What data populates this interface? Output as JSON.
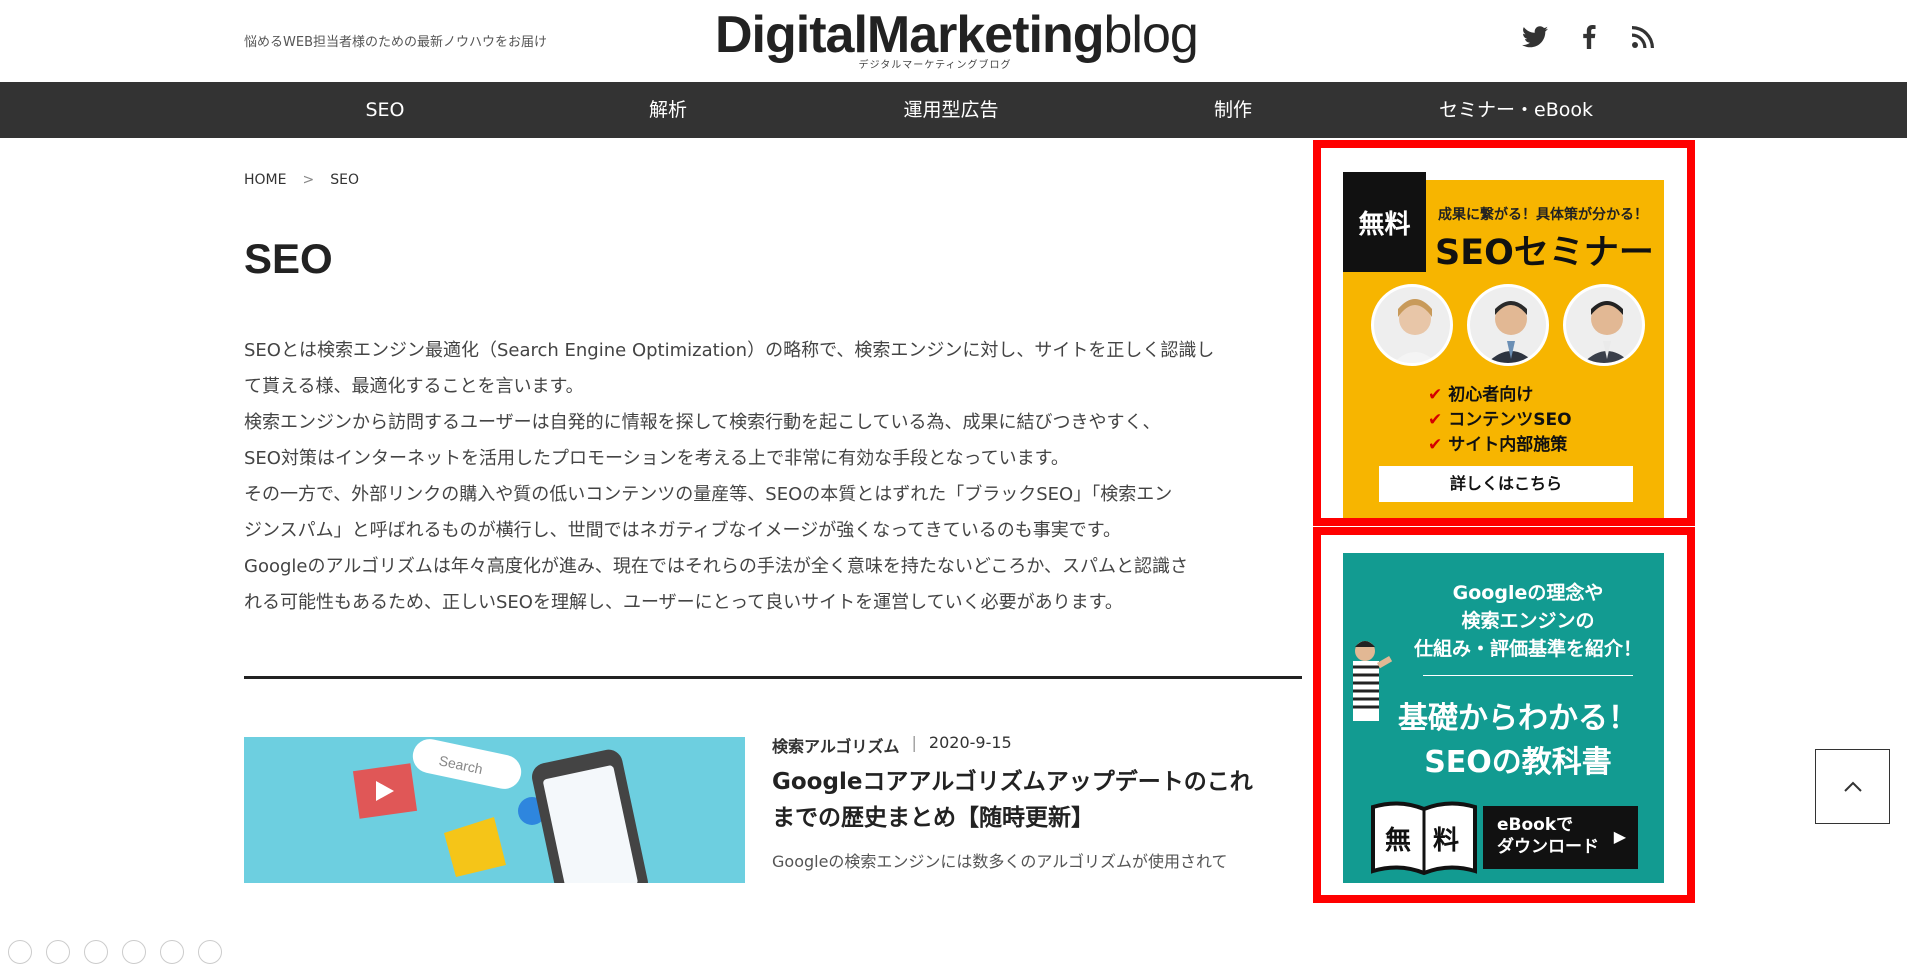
{
  "header": {
    "tagline": "悩めるWEB担当者様のための最新ノウハウをお届け",
    "logo_bold": "DigitalMarketing",
    "logo_light": "blog",
    "logo_sub": "デジタルマーケティングブログ",
    "social_icons": [
      "twitter-icon",
      "facebook-icon",
      "rss-icon"
    ]
  },
  "nav": {
    "items": [
      "SEO",
      "解析",
      "運用型広告",
      "制作",
      "セミナー・eBook"
    ]
  },
  "breadcrumb": {
    "home": "HOME",
    "separator": ">",
    "current": "SEO"
  },
  "page": {
    "title": "SEO",
    "description": [
      "SEOとは検索エンジン最適化（Search Engine Optimization）の略称で、検索エンジンに対し、サイトを正しく認識し",
      "て貰える様、最適化することを言います。",
      "検索エンジンから訪問するユーザーは自発的に情報を探して検索行動を起こしている為、成果に結びつきやすく、",
      "SEO対策はインターネットを活用したプロモーションを考える上で非常に有効な手段となっています。",
      "その一方で、外部リンクの購入や質の低いコンテンツの量産等、SEOの本質とはずれた「ブラックSEO」「検索エン",
      "ジンスパム」と呼ばれるものが横行し、世間ではネガティブなイメージが強くなってきているのも事実です。",
      "Googleのアルゴリズムは年々高度化が進み、現在ではそれらの手法が全く意味を持たないどころか、スパムと認識さ",
      "れる可能性もあるため、正しいSEOを理解し、ユーザーにとって良いサイトを運営していく必要があります。"
    ]
  },
  "article": {
    "category": "検索アルゴリズム",
    "separator": "|",
    "date": "2020-9-15",
    "title": "Googleコアアルゴリズムアップデートのこれまでの歴史まとめ【随時更新】",
    "excerpt": "Googleの検索エンジンには数多くのアルゴリズムが使用されて",
    "thumb_search_text": "Search"
  },
  "seo_banner": {
    "free_label": "無料",
    "subtitle": "成果に繋がる！具体策が分かる！",
    "title": "SEOセミナー",
    "checks": [
      "初心者向け",
      "コンテンツSEO",
      "サイト内部施策"
    ],
    "cta": "詳しくはこちら",
    "bg_color": "#f7b500"
  },
  "ebook_banner": {
    "lead_lines": [
      "Googleの理念や",
      "検索エンジンの",
      "仕組み・評価基準を紹介！"
    ],
    "title_lines": [
      "基礎からわかる！",
      "SEOの教科書"
    ],
    "book_chars": [
      "無",
      "料"
    ],
    "dl_lines": [
      "eBookで",
      "ダウンロード"
    ],
    "bg_color": "#129b91"
  },
  "colors": {
    "nav_bg": "#333333",
    "highlight_frame": "#ff0000"
  }
}
